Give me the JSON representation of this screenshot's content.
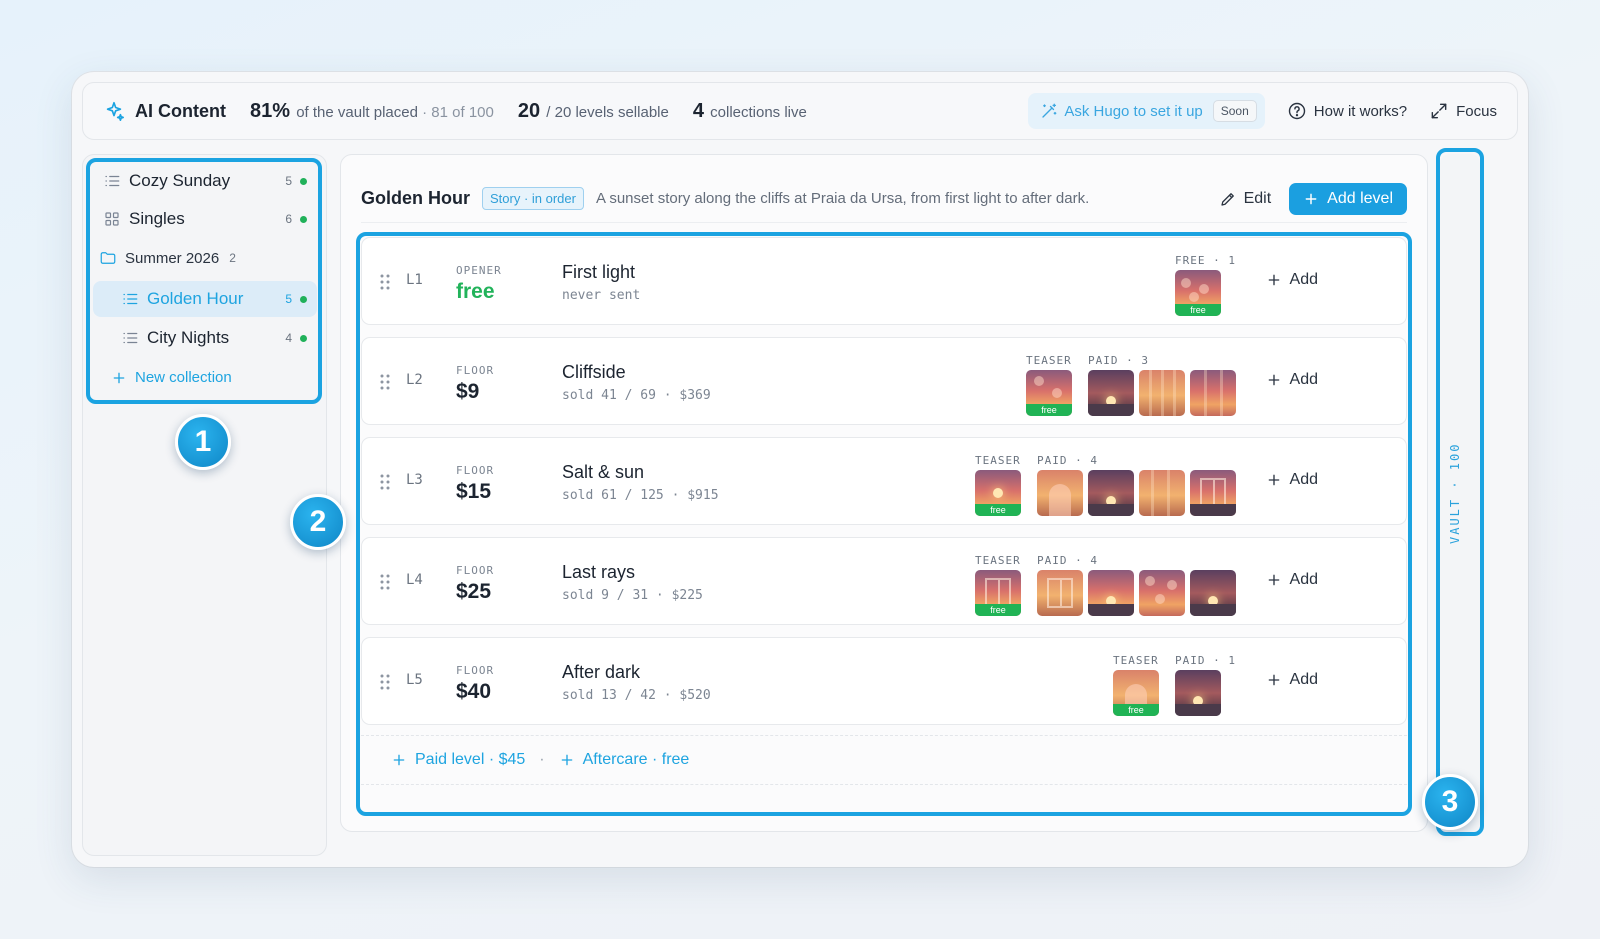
{
  "header": {
    "app_name": "AI Content",
    "vault_pct": "81%",
    "vault_text": "of the vault placed",
    "vault_count": "· 81 of 100",
    "levels_num": "20",
    "levels_text": "/ 20 levels sellable",
    "collections_num": "4",
    "collections_text": "collections live",
    "ask_label": "Ask Hugo to set it up",
    "soon_label": "Soon",
    "how_label": "How it works?",
    "focus_label": "Focus"
  },
  "sidebar": {
    "items": [
      {
        "label": "Cozy Sunday",
        "count": "5"
      },
      {
        "label": "Singles",
        "count": "6"
      }
    ],
    "folder": {
      "label": "Summer 2026",
      "count": "2"
    },
    "sub_items": [
      {
        "label": "Golden Hour",
        "count": "5"
      },
      {
        "label": "City Nights",
        "count": "4"
      }
    ],
    "new_collection": "New collection"
  },
  "main": {
    "title": "Golden Hour",
    "badge": "Story · in order",
    "description": "A sunset story along the cliffs at Praia da Ursa, from first light to after dark.",
    "edit_label": "Edit",
    "add_level_label": "Add level",
    "free_tag": "free",
    "add_label": "Add",
    "levels": [
      {
        "id": "L1",
        "kind": "OPENER",
        "price": "free",
        "name": "First light",
        "sub": "never sent",
        "teaser_label": "",
        "paid_label": "FREE · 1"
      },
      {
        "id": "L2",
        "kind": "FLOOR",
        "price": "$9",
        "name": "Cliffside",
        "sub": "sold 41 / 69 · $369",
        "teaser_label": "TEASER",
        "paid_label": "PAID · 3"
      },
      {
        "id": "L3",
        "kind": "FLOOR",
        "price": "$15",
        "name": "Salt & sun",
        "sub": "sold 61 / 125 · $915",
        "teaser_label": "TEASER",
        "paid_label": "PAID · 4"
      },
      {
        "id": "L4",
        "kind": "FLOOR",
        "price": "$25",
        "name": "Last rays",
        "sub": "sold 9 / 31 · $225",
        "teaser_label": "TEASER",
        "paid_label": "PAID · 4"
      },
      {
        "id": "L5",
        "kind": "FLOOR",
        "price": "$40",
        "name": "After dark",
        "sub": "sold 13 / 42 · $520",
        "teaser_label": "TEASER",
        "paid_label": "PAID · 1"
      }
    ],
    "footer": {
      "paid_level": "Paid level · $45",
      "separator": "·",
      "aftercare": "Aftercare · free"
    }
  },
  "vault": {
    "label": "VAULT · 100"
  },
  "callouts": [
    "1",
    "2",
    "3"
  ],
  "colors": {
    "accent": "#1ba3e1",
    "free_green": "#20b355",
    "status_dot": "#20b15a"
  }
}
